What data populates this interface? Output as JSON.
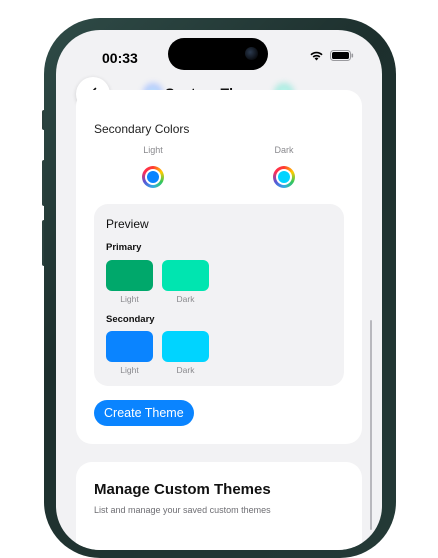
{
  "status": {
    "time": "00:33"
  },
  "nav": {
    "title": "Custom Themes"
  },
  "secondary": {
    "title": "Secondary Colors",
    "light_label": "Light",
    "dark_label": "Dark",
    "light_color": "#0a84ff",
    "dark_color": "#00d4ff"
  },
  "preview": {
    "title": "Preview",
    "primary_label": "Primary",
    "secondary_label": "Secondary",
    "light_label": "Light",
    "dark_label": "Dark",
    "colors": {
      "primary_light": "#00a86b",
      "primary_dark": "#00e5b0",
      "secondary_light": "#0a84ff",
      "secondary_dark": "#00d4ff"
    }
  },
  "create_button": "Create Theme",
  "manage": {
    "title": "Manage Custom Themes",
    "subtitle": "List and manage your saved custom themes"
  }
}
